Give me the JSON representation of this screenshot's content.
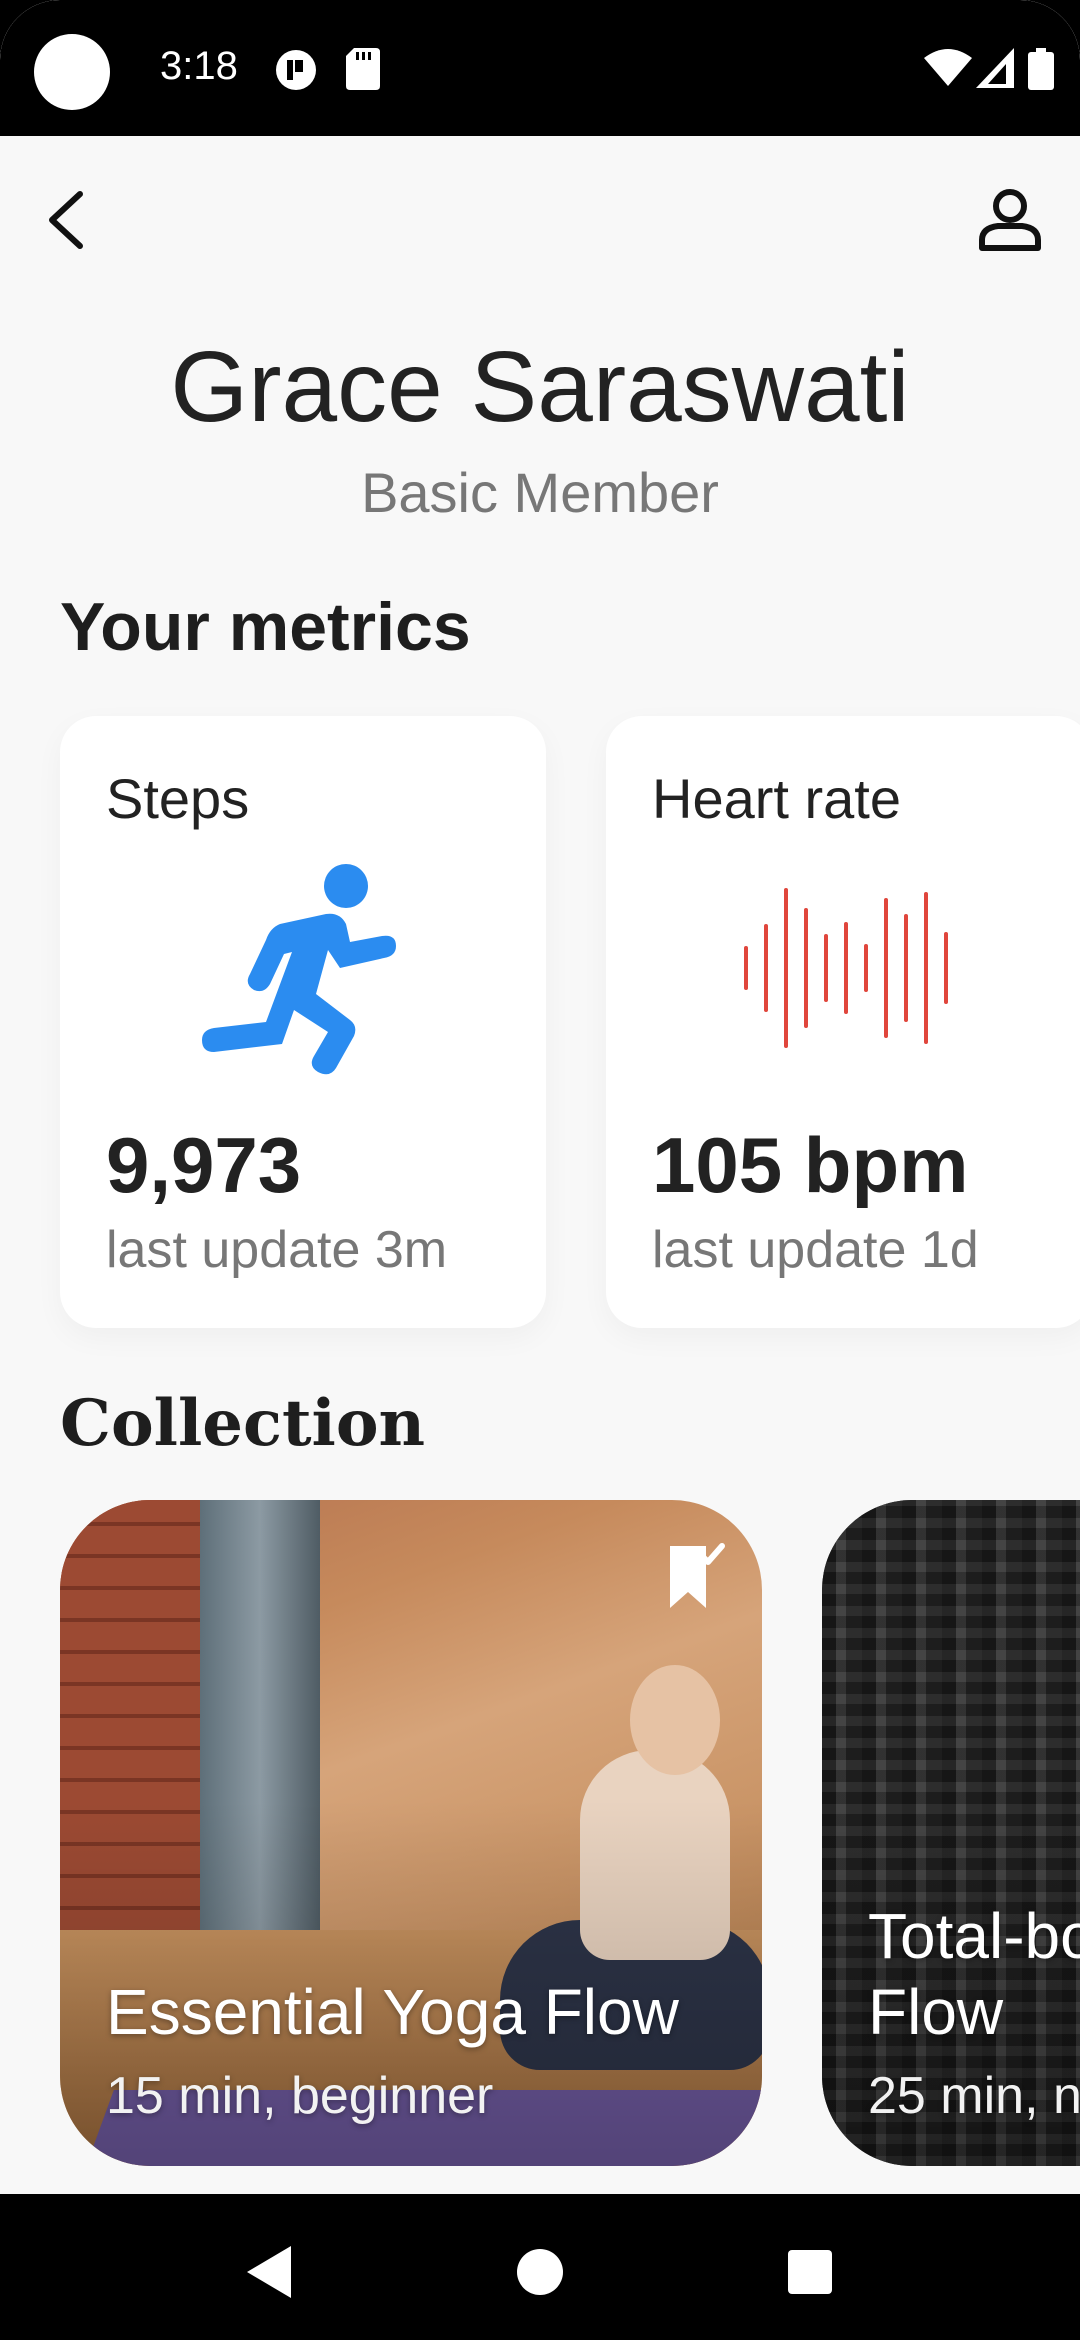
{
  "status_bar": {
    "time": "3:18",
    "icons": [
      "notification-app-icon",
      "sd-card-icon",
      "wifi-icon",
      "cellular-signal-icon",
      "battery-icon"
    ]
  },
  "top_bar": {
    "back_icon": "chevron-left-icon",
    "profile_icon": "person-outline-icon"
  },
  "user": {
    "name": "Grace Saraswati",
    "membership": "Basic Member"
  },
  "metrics": {
    "title": "Your metrics",
    "cards": [
      {
        "label": "Steps",
        "icon": "running-person-icon",
        "icon_color": "#2b8cf0",
        "value": "9,973",
        "update": "last update 3m"
      },
      {
        "label": "Heart rate",
        "icon": "heart-rate-waveform-icon",
        "icon_color": "#e0463c",
        "value": "105 bpm",
        "update": "last update 1d"
      }
    ]
  },
  "collection": {
    "title": "Collection",
    "items": [
      {
        "name": "Essential Yoga Flow",
        "meta": "15 min, beginner",
        "bookmark_icon": "bookmark-check-icon"
      },
      {
        "name_line1": "Total-bo",
        "name_line2": "Flow",
        "meta": "25 min, n"
      }
    ]
  },
  "nav_bar": {
    "back": "nav-back-icon",
    "home": "nav-home-icon",
    "recents": "nav-recents-icon"
  }
}
